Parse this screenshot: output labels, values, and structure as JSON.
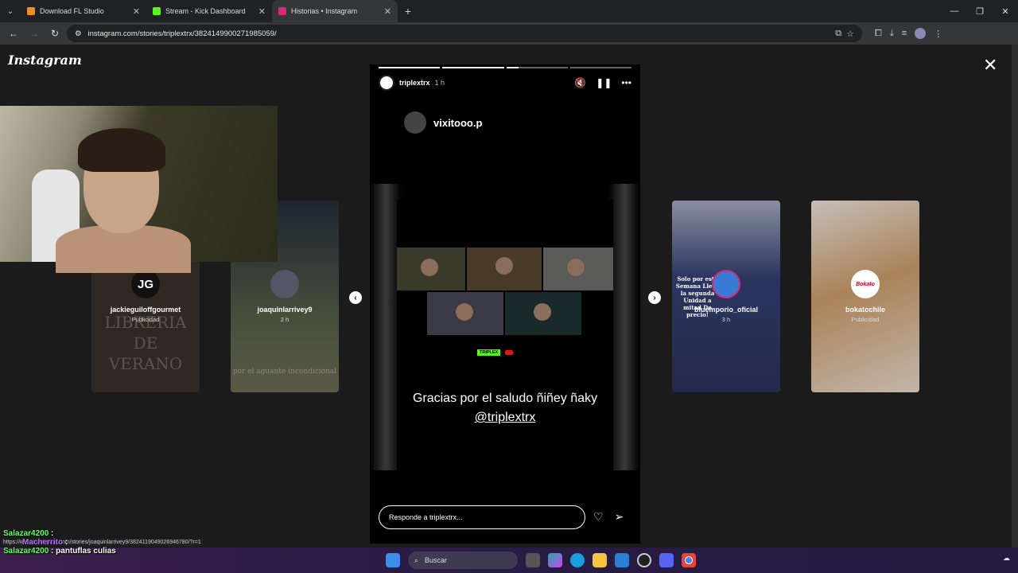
{
  "tabs": [
    {
      "title": "Download FL Studio",
      "color": "#f28c28",
      "active": false
    },
    {
      "title": "Stream - Kick Dashboard",
      "color": "#53fc18",
      "active": false
    },
    {
      "title": "Historias • Instagram",
      "color": "#d62976",
      "active": true
    }
  ],
  "address": {
    "url": "instagram.com/stories/triplextrx/3824149900271985059/"
  },
  "page": {
    "logo": "Instagram"
  },
  "side_cards": [
    {
      "user": "jackieguiloffgourmet",
      "sub": "Publicidad",
      "avatar": "JG",
      "overlay": "LIBRERIA DE VERANO",
      "bg": "#4a3e35"
    },
    {
      "user": "joaquinlarrivey9",
      "sub": "2 h",
      "avatar": "",
      "overlay": "por el aguante incondicional",
      "bg": "#5a6a58"
    },
    {
      "user": "bluemporio_oficial",
      "sub": "3 h",
      "avatar": "",
      "overlay": "Solo por esta Semana Lleva la segunda Unidad a mitad De precio!",
      "bg": "#3a4270"
    },
    {
      "user": "bokatochile",
      "sub": "Publicidad",
      "avatar": "Bokato",
      "overlay": "",
      "bg": "#b58a5a"
    }
  ],
  "story": {
    "user": "triplextrx",
    "time": "1 h",
    "mention": "vixitooo.p",
    "caption_line1": "Gracias por el saludo ñiñey ñaky",
    "caption_tag": "@triplextrx",
    "brand": "TRIPLEX",
    "reply_placeholder": "Responde a triplextrx...",
    "progress": [
      1,
      1,
      0.2,
      0
    ]
  },
  "chat": [
    {
      "user": "Salazar4200",
      "text": ""
    },
    {
      "user": "Macherrito",
      "text": ""
    },
    {
      "user": "Salazar4200",
      "text": "pantuflas culias"
    }
  ],
  "status_url": "https://www.instagram.com/stories/joaquinlarrivey9/3824119049026946780/?r=1",
  "taskbar": {
    "search_placeholder": "Buscar"
  }
}
